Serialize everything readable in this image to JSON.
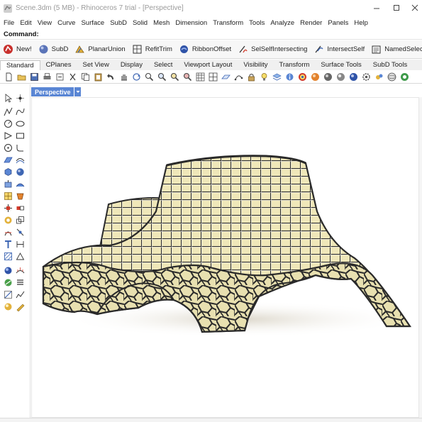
{
  "window": {
    "title": "Scene.3dm (5 MB) - Rhinoceros 7 trial - [Perspective]"
  },
  "menu": [
    "File",
    "Edit",
    "View",
    "Curve",
    "Surface",
    "SubD",
    "Solid",
    "Mesh",
    "Dimension",
    "Transform",
    "Tools",
    "Analyze",
    "Render",
    "Panels",
    "Help"
  ],
  "command": {
    "prompt": "Command:"
  },
  "command_buttons": [
    {
      "label": "New!",
      "icon": "rhino-new-icon"
    },
    {
      "label": "SubD",
      "icon": "subd-sphere-icon"
    },
    {
      "label": "PlanarUnion",
      "icon": "planar-union-icon"
    },
    {
      "label": "RefitTrim",
      "icon": "refit-trim-icon"
    },
    {
      "label": "RibbonOffset",
      "icon": "ribbon-offset-icon"
    },
    {
      "label": "SelSelfIntersecting",
      "icon": "sel-self-intersecting-icon"
    },
    {
      "label": "IntersectSelf",
      "icon": "intersect-self-icon"
    },
    {
      "label": "NamedSelection",
      "icon": "named-selection-icon"
    }
  ],
  "toolbar_tabs": [
    "Standard",
    "CPlanes",
    "Set View",
    "Display",
    "Select",
    "Viewport Layout",
    "Visibility",
    "Transform",
    "Surface Tools",
    "SubD Tools"
  ],
  "active_tab": "Standard",
  "viewport": {
    "name": "Perspective"
  },
  "colors": {
    "viewport_tab": "#5a86d4",
    "surface_fill": "#efe7b9",
    "wireframe": "#2a2a2a"
  }
}
